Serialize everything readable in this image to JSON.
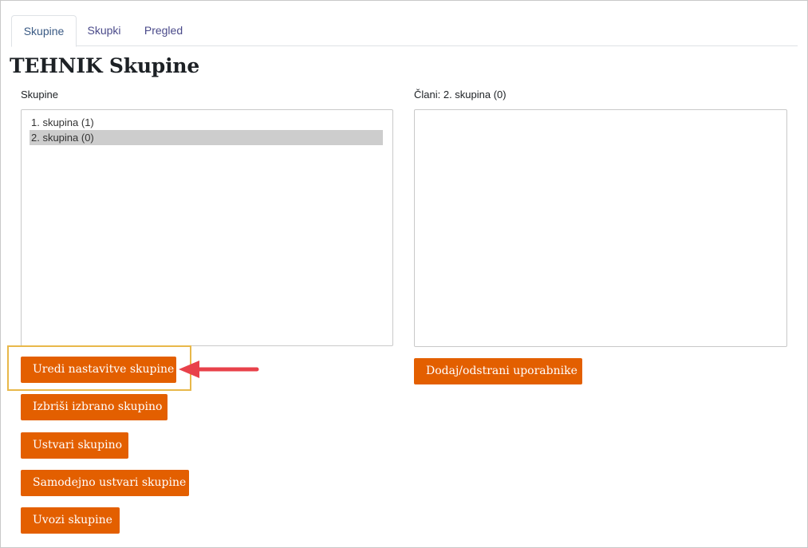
{
  "tabs": [
    {
      "label": "Skupine",
      "active": true
    },
    {
      "label": "Skupki",
      "active": false
    },
    {
      "label": "Pregled",
      "active": false
    }
  ],
  "page_title": "TEHNIK Skupine",
  "groups_panel": {
    "label": "Skupine",
    "options": [
      {
        "text": "1. skupina (1)",
        "selected": false
      },
      {
        "text": "2. skupina (0)",
        "selected": true
      }
    ]
  },
  "members_panel": {
    "label": "Člani: 2. skupina (0)",
    "options": []
  },
  "buttons": {
    "edit_group": "Uredi nastavitve skupine",
    "delete_group": "Izbriši izbrano skupino",
    "create_group": "Ustvari skupino",
    "auto_create": "Samodejno ustvari skupine",
    "import_groups": "Uvozi skupine",
    "add_remove_users": "Dodaj/odstrani uporabnike"
  },
  "colors": {
    "button": "#e35f00",
    "highlight": "#e8b84a",
    "arrow": "#e8414a",
    "selected_row": "#cdcdcd"
  },
  "annotation": {
    "highlight_target": "edit_group",
    "arrow_icon": "red-arrow-icon"
  }
}
